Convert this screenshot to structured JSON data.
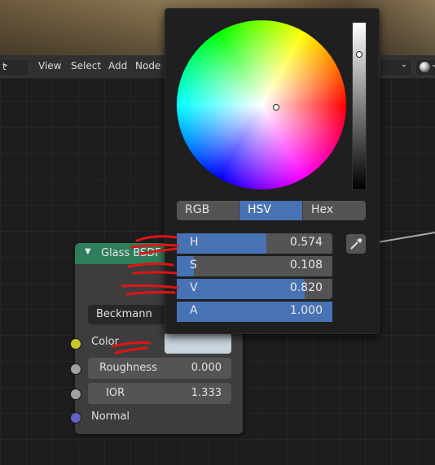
{
  "header": {
    "editor_type_label": "t",
    "menu": [
      "View",
      "Select",
      "Add",
      "Node"
    ]
  },
  "node": {
    "title": "Glass BSDF",
    "distribution": "Beckmann",
    "inputs": {
      "color_label": "Color",
      "color_value": "#c7d3dd",
      "roughness_label": "Roughness",
      "roughness_value": "0.000",
      "ior_label": "IOR",
      "ior_value": "1.333",
      "normal_label": "Normal"
    },
    "header_color": "#2e7d5b"
  },
  "color_picker": {
    "modes": [
      "RGB",
      "HSV",
      "Hex"
    ],
    "active_mode": "HSV",
    "value_bar_level": 0.82,
    "sliders": [
      {
        "label": "H",
        "value": "0.574",
        "fraction": 0.574
      },
      {
        "label": "S",
        "value": "0.108",
        "fraction": 0.108
      },
      {
        "label": "V",
        "value": "0.820",
        "fraction": 0.82
      },
      {
        "label": "A",
        "value": "1.000",
        "fraction": 1.0
      }
    ],
    "accent_color": "#4772b3"
  },
  "icons": {
    "chevron": "chevron-down-icon",
    "eyedropper": "eyedropper-icon",
    "collapse": "collapse-triangle-icon",
    "shading": "material-preview-icon"
  }
}
